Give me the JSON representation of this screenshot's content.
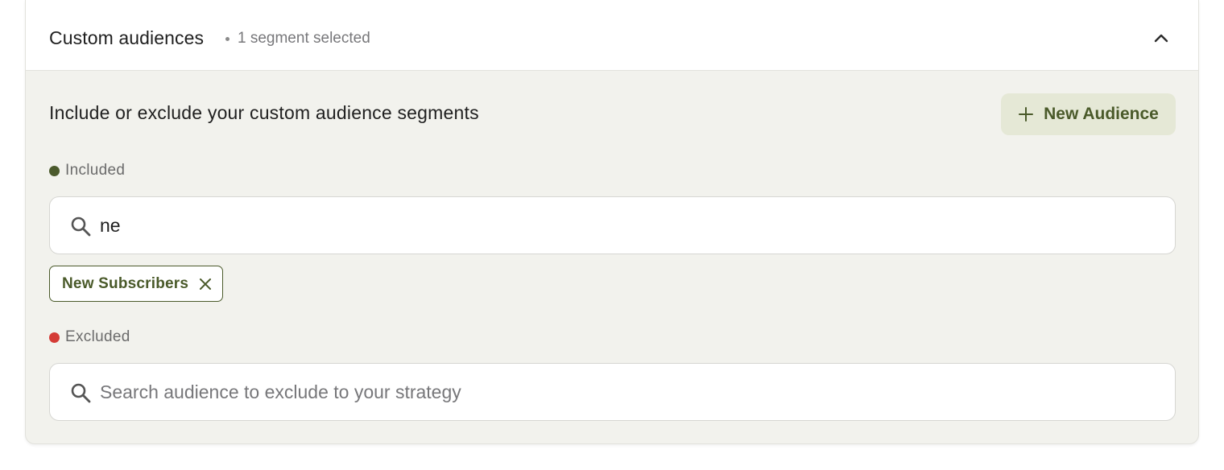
{
  "header": {
    "title": "Custom audiences",
    "subtitle": "1 segment selected",
    "collapse_icon": "chevron-up-icon"
  },
  "description": "Include or exclude your custom audience segments",
  "new_audience_button": {
    "label": "New Audience",
    "icon": "plus-icon"
  },
  "included": {
    "label": "Included",
    "dot_color": "#4b5a2c",
    "search": {
      "value": "ne",
      "placeholder": "",
      "icon": "search-icon"
    },
    "chips": [
      {
        "label": "New Subscribers",
        "remove_icon": "close-icon"
      }
    ]
  },
  "excluded": {
    "label": "Excluded",
    "dot_color": "#d43b36",
    "search": {
      "value": "",
      "placeholder": "Search audience to exclude to your strategy",
      "icon": "search-icon"
    }
  },
  "colors": {
    "accent": "#4a5a2a",
    "accent_bg": "#e5e8d6",
    "panel_bg": "#f2f2ed"
  }
}
